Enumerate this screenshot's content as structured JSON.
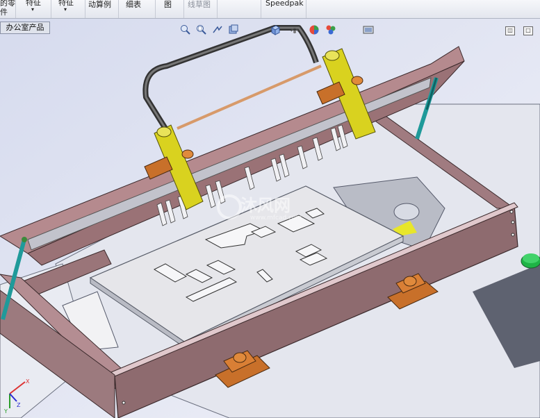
{
  "ribbon": {
    "groups": [
      {
        "lines": [
          "的零",
          "件"
        ]
      },
      {
        "lines": [
          "特征",
          "▾"
        ]
      },
      {
        "lines": [
          "特征",
          "▾"
        ]
      },
      {
        "lines": [
          "动算例"
        ]
      },
      {
        "lines": [
          "细表"
        ]
      },
      {
        "lines": [
          "图"
        ]
      },
      {
        "lines": [
          "线草图"
        ],
        "disabled": true
      },
      {
        "lines": [
          "Speedpak"
        ]
      }
    ]
  },
  "tabs": {
    "office_products": "办公室产品"
  },
  "watermark": {
    "logo_text": "沐风网",
    "url": "www.mfcad.com"
  },
  "colors": {
    "background": "#e8eaf6",
    "frame": "#8c6a6e",
    "plate": "#e8e8ec",
    "bracket": "#c8702a",
    "arm": "#d9d21f",
    "strut": "#1f9a9a",
    "button": "#1fb446"
  },
  "heads_up_icons": [
    "zoom-to-fit-icon",
    "zoom-area-icon",
    "previous-view-icon",
    "section-view-icon",
    "view-orientation-icon",
    "display-style-icon",
    "hide-show-icon",
    "edit-appearance-icon",
    "apply-scene-icon",
    "view-settings-icon"
  ],
  "triad": {
    "x": "X",
    "y": "Y",
    "z": "Z"
  }
}
